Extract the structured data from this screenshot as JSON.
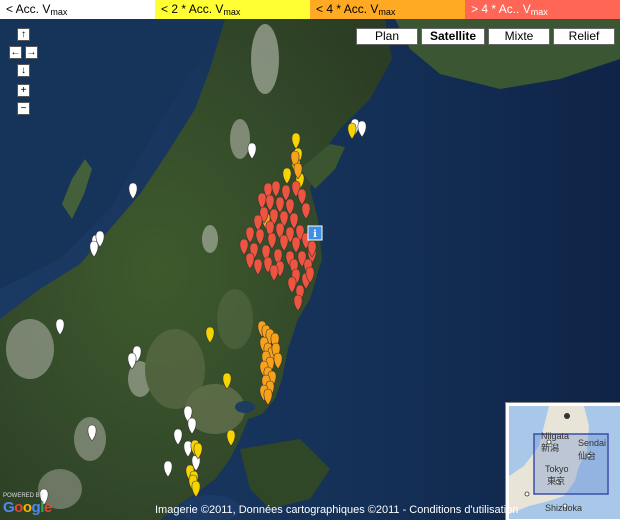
{
  "legend": [
    {
      "prefix": "< Acc. V",
      "sub": "max",
      "color": "#ffffff"
    },
    {
      "prefix": "< 2 * Acc. V",
      "sub": "max",
      "color": "#ffff33"
    },
    {
      "prefix": "< 4 * Acc. V",
      "sub": "max",
      "color": "#ffaa22"
    },
    {
      "prefix": "> 4 * Ac.. V",
      "sub": "max",
      "color": "#ff6655"
    }
  ],
  "map_types": {
    "plan": "Plan",
    "satellite": "Satellite",
    "mixte": "Mixte",
    "relief": "Relief",
    "active": "satellite"
  },
  "nav": {
    "up": "↑",
    "left": "←",
    "right": "→",
    "down": "↓",
    "zoom_in": "+",
    "zoom_out": "−"
  },
  "attribution": "Imagerie ©2011, Données cartographiques ©2011 - Conditions d'utilisation",
  "logo": {
    "powered": "POWERED BY",
    "word": "Google"
  },
  "overview": {
    "labels": {
      "niigata": "Niigata",
      "niigata_jp": "新潟",
      "sendai": "Sendai",
      "sendai_jp": "仙台",
      "tokyo": "Tokyo",
      "tokyo_jp": "東京",
      "shizuoka": "Shizuoka"
    }
  },
  "markers": {
    "colors": {
      "white": "#ffffff",
      "yellow": "#f5d400",
      "orange": "#f7a21a",
      "red": "#ee5540"
    }
  }
}
